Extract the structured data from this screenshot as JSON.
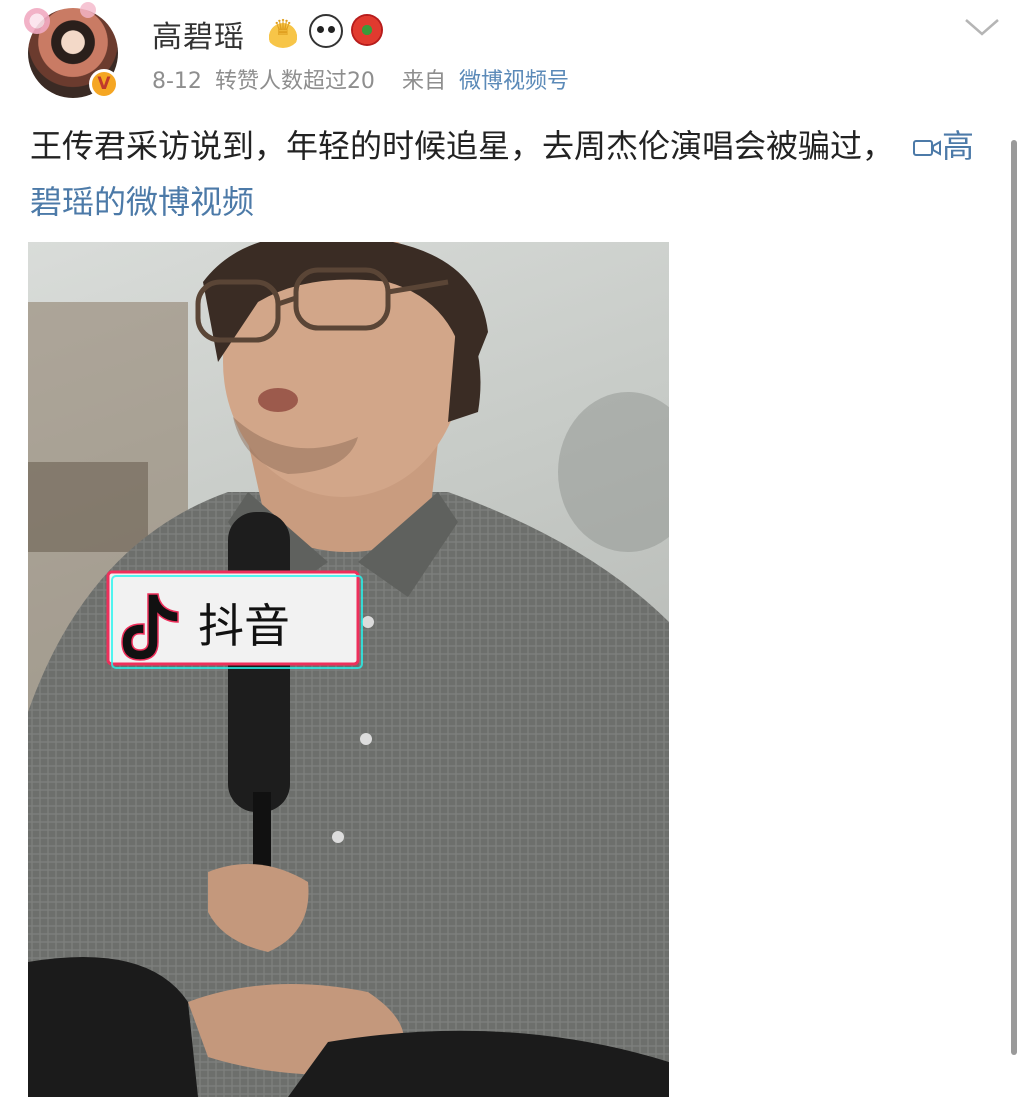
{
  "post": {
    "author": {
      "name": "高碧瑶",
      "verified_badge": "V",
      "avatar_icon": "avatar-portrait",
      "badges": [
        "crown-member-icon",
        "panda-icon",
        "red-flower-icon"
      ]
    },
    "date": "8-12",
    "reposts": "转赞人数超过20",
    "source_prefix": "来自",
    "source": "微博视频号",
    "text": "王传君采访说到，年轻的时候追星，去周杰伦演唱会被骗过，",
    "video_link_label": "高碧瑶的微博视频",
    "video_icon": "video-camera-icon",
    "menu_icon": "chevron-down-icon",
    "watermark": "抖音"
  },
  "colors": {
    "link": "#4c7aa8",
    "meta": "#8e8e8e",
    "text": "#222222",
    "verified": "#f5a623"
  }
}
